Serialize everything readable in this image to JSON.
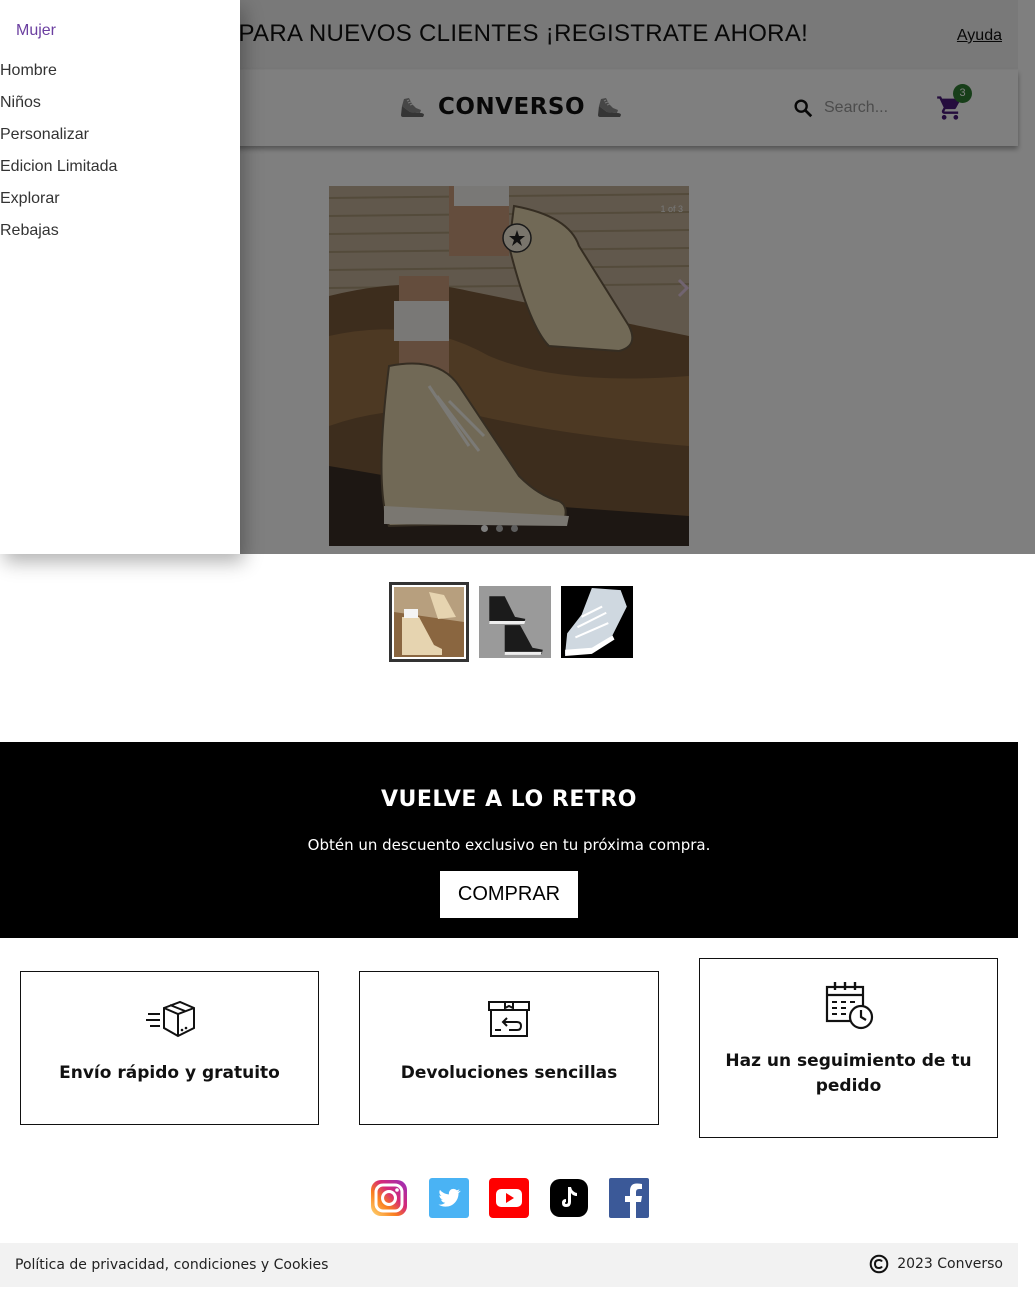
{
  "promo": {
    "text": "% PARA NUEVOS CLIENTES ¡REGISTRATE AHORA!",
    "help_link": "Ayuda"
  },
  "header": {
    "brand": "CONVERSO",
    "search_placeholder": "Search...",
    "cart_count": "3"
  },
  "drawer": {
    "items": [
      "Mujer",
      "Hombre",
      "Niños",
      "Personalizar",
      "Edicion Limitada",
      "Explorar",
      "Rebajas"
    ],
    "active_color": "#6b3fa0"
  },
  "gallery": {
    "counter": "1 of 3",
    "thumbnails": [
      "beige-high-top-thumb",
      "black-high-top-thumb",
      "white-sneaker-thumb"
    ]
  },
  "retro": {
    "title": "VUELVE A LO RETRO",
    "subtitle": "Obtén un descuento exclusivo en tu próxima compra.",
    "button": "COMPRAR"
  },
  "features": [
    {
      "label": "Envío rápido y gratuito",
      "icon": "delivery-box-icon"
    },
    {
      "label": "Devoluciones sencillas",
      "icon": "return-box-icon"
    },
    {
      "label": "Haz un seguimiento de tu pedido",
      "icon": "calendar-clock-icon"
    }
  ],
  "social": [
    "instagram-icon",
    "twitter-icon",
    "youtube-icon",
    "tiktok-icon",
    "facebook-icon"
  ],
  "footer": {
    "policy": "Política de privacidad, condiciones y Cookies",
    "copyright": "2023 Converso"
  },
  "colors": {
    "cart_badge": "#2e7d32",
    "cart_icon": "#4a1a7a",
    "retro_bg": "#000000"
  }
}
